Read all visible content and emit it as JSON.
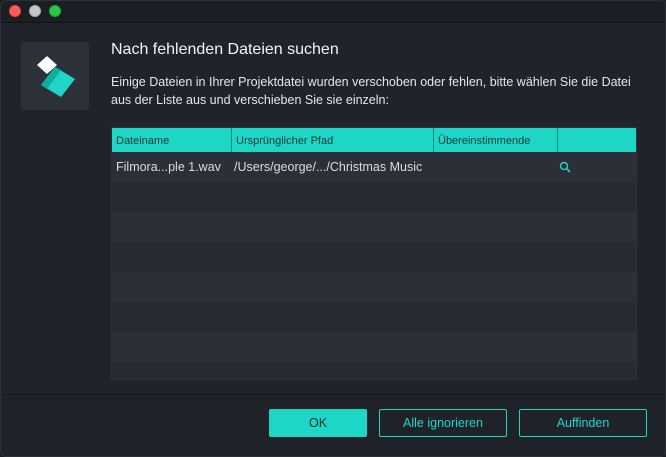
{
  "window": {
    "controls": [
      "close",
      "minimize",
      "zoom"
    ]
  },
  "dialog": {
    "title": "Nach fehlenden Dateien suchen",
    "description": "Einige Dateien in Ihrer Projektdatei wurden verschoben oder fehlen, bitte wählen Sie die Datei aus der Liste aus und verschieben Sie sie einzeln:",
    "logo_icon": "filmora-logo-icon"
  },
  "table": {
    "columns": [
      "Dateiname",
      "Ursprünglicher Pfad",
      "Übereinstimmende",
      ""
    ],
    "rows": [
      {
        "filename": "Filmora...ple 1.wav",
        "path": "/Users/george/.../Christmas Music",
        "match": "",
        "action_icon": "search-icon"
      }
    ],
    "empty_row_count": 7
  },
  "buttons": {
    "ok": "OK",
    "ignore_all": "Alle ignorieren",
    "find": "Auffinden"
  },
  "colors": {
    "accent": "#1dd6c6",
    "background": "#20242a",
    "row_odd": "#2b3038",
    "row_even": "#262a31"
  }
}
